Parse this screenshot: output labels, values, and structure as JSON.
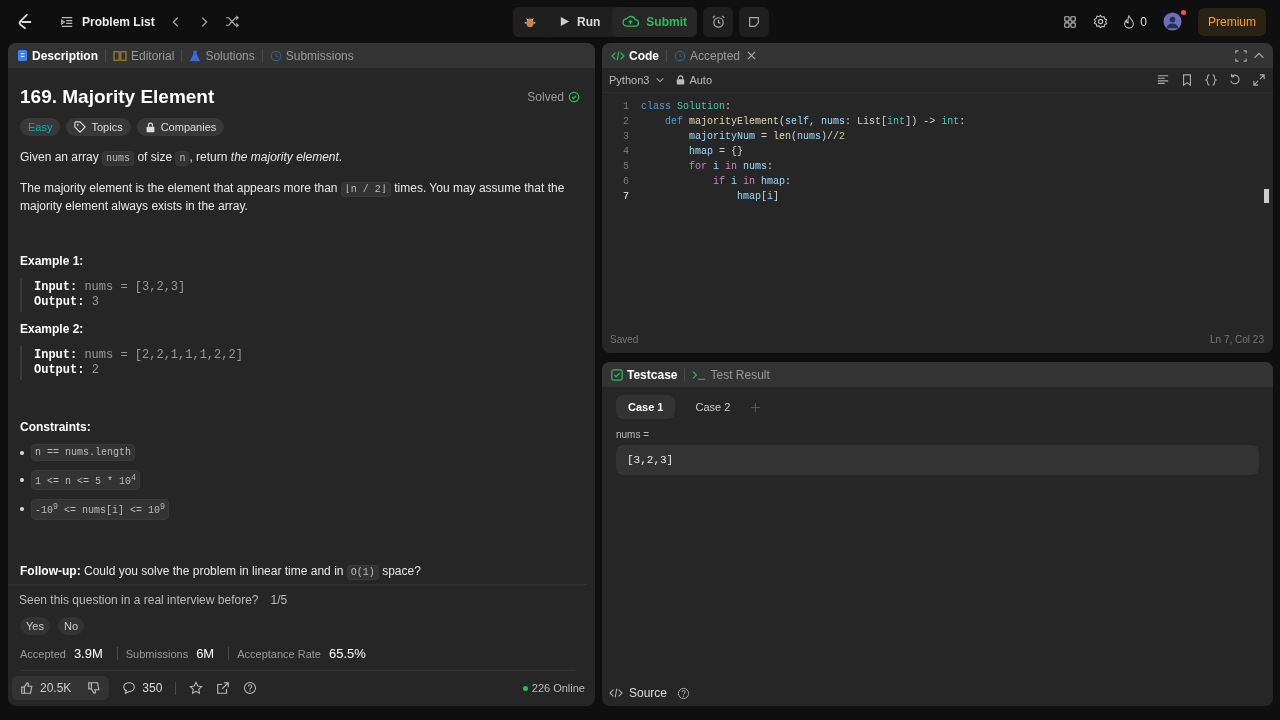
{
  "topbar": {
    "problem_list": "Problem List",
    "run": "Run",
    "submit": "Submit",
    "streak": "0",
    "premium": "Premium",
    "notification": true
  },
  "description_panel": {
    "tabs": [
      {
        "label": "Description",
        "selected": true
      },
      {
        "label": "Editorial",
        "selected": false
      },
      {
        "label": "Solutions",
        "selected": false
      },
      {
        "label": "Submissions",
        "selected": false
      }
    ],
    "title": "169. Majority Element",
    "status": "Solved",
    "difficulty": "Easy",
    "tags": [
      "Topics",
      "Companies"
    ],
    "paragraphs": [
      {
        "segments": [
          {
            "kind": "text",
            "text": "Given an array "
          },
          {
            "kind": "code",
            "text": "nums"
          },
          {
            "kind": "text",
            "text": " of size "
          },
          {
            "kind": "code",
            "text": "n"
          },
          {
            "kind": "text",
            "text": ", return "
          },
          {
            "kind": "em",
            "text": "the majority element"
          },
          {
            "kind": "text",
            "text": "."
          }
        ]
      },
      {
        "segments": [
          {
            "kind": "text",
            "text": "The majority element is the element that appears more than "
          },
          {
            "kind": "code",
            "text": "⌊n / 2⌋"
          },
          {
            "kind": "text",
            "text": " times. You may assume that the majority element always exists in the array."
          }
        ]
      }
    ],
    "examples": [
      {
        "title": "Example 1:",
        "input_label": "Input:",
        "input": "nums = [3,2,3]",
        "output_label": "Output:",
        "output": "3"
      },
      {
        "title": "Example 2:",
        "input_label": "Input:",
        "input": "nums = [2,2,1,1,1,2,2]",
        "output_label": "Output:",
        "output": "2"
      }
    ],
    "constraints_title": "Constraints:",
    "constraints": [
      "n == nums.length",
      "1 <= n <= 5 * 10$^{4}$",
      "-10$^{9}$ <= nums[i] <= 10$^{9}$"
    ],
    "followup": {
      "segments": [
        {
          "kind": "strong",
          "text": "Follow-up:"
        },
        {
          "kind": "text",
          "text": " Could you solve the problem in linear time and in "
        },
        {
          "kind": "code",
          "text": "O(1)"
        },
        {
          "kind": "text",
          "text": " space?"
        }
      ]
    },
    "interview": {
      "question": "Seen this question in a real interview before?",
      "count": "1/5",
      "buttons": [
        "Yes",
        "No"
      ]
    },
    "stats": [
      {
        "label": "Accepted",
        "value": "3.9M"
      },
      {
        "label": "Submissions",
        "value": "6M"
      },
      {
        "label": "Acceptance Rate",
        "value": "65.5%"
      }
    ],
    "footer": {
      "likes": "20.5K",
      "comments": "350",
      "online": "226 Online"
    }
  },
  "code_panel": {
    "tabs": [
      {
        "label": "Code",
        "selected": true
      },
      {
        "label": "Accepted",
        "selected": false
      }
    ],
    "language": "Python3",
    "mode": "Auto",
    "lines": [
      {
        "number": "1",
        "current": false,
        "tokens": [
          {
            "kind": "keyword",
            "text": "class"
          },
          {
            "kind": "type",
            "text": " Solution"
          },
          {
            "kind": "plain",
            "text": ":"
          }
        ]
      },
      {
        "number": "2",
        "current": false,
        "tokens": [
          {
            "kind": "keyword",
            "text": "    def"
          },
          {
            "kind": "function",
            "text": " majorityElement"
          },
          {
            "kind": "plain",
            "text": "("
          },
          {
            "kind": "variable",
            "text": "self"
          },
          {
            "kind": "plain",
            "text": ", "
          },
          {
            "kind": "variable",
            "text": "nums"
          },
          {
            "kind": "plain",
            "text": ": List["
          },
          {
            "kind": "type",
            "text": "int"
          },
          {
            "kind": "plain",
            "text": "]) -> "
          },
          {
            "kind": "type",
            "text": "int"
          },
          {
            "kind": "plain",
            "text": ":"
          }
        ]
      },
      {
        "number": "3",
        "current": false,
        "tokens": [
          {
            "kind": "variable",
            "text": "        majorityNum"
          },
          {
            "kind": "plain",
            "text": " = "
          },
          {
            "kind": "function",
            "text": "len"
          },
          {
            "kind": "plain",
            "text": "("
          },
          {
            "kind": "variable",
            "text": "nums"
          },
          {
            "kind": "plain",
            "text": ")//"
          },
          {
            "kind": "number",
            "text": "2"
          }
        ]
      },
      {
        "number": "4",
        "current": false,
        "tokens": [
          {
            "kind": "variable",
            "text": "        hmap"
          },
          {
            "kind": "plain",
            "text": " = {}"
          }
        ]
      },
      {
        "number": "5",
        "current": false,
        "tokens": [
          {
            "kind": "control",
            "text": "        for"
          },
          {
            "kind": "variable",
            "text": " i"
          },
          {
            "kind": "control",
            "text": " in"
          },
          {
            "kind": "variable",
            "text": " nums"
          },
          {
            "kind": "plain",
            "text": ":"
          }
        ]
      },
      {
        "number": "6",
        "current": false,
        "tokens": [
          {
            "kind": "control",
            "text": "            if"
          },
          {
            "kind": "variable",
            "text": " i"
          },
          {
            "kind": "control",
            "text": " in"
          },
          {
            "kind": "variable",
            "text": " hmap"
          },
          {
            "kind": "plain",
            "text": ":"
          }
        ]
      },
      {
        "number": "7",
        "current": true,
        "tokens": [
          {
            "kind": "variable",
            "text": "                hmap"
          },
          {
            "kind": "plain",
            "text": "["
          },
          {
            "kind": "variable",
            "text": "i"
          },
          {
            "kind": "plain",
            "text": "]"
          }
        ]
      }
    ],
    "status": "Saved",
    "cursor": "Ln 7, Col 23"
  },
  "testcase_panel": {
    "tabs": [
      {
        "label": "Testcase",
        "selected": true
      },
      {
        "label": "Test Result",
        "selected": false
      }
    ],
    "cases": [
      {
        "label": "Case 1",
        "selected": true
      },
      {
        "label": "Case 2",
        "selected": false
      }
    ],
    "param_label": "nums =",
    "param_value": "[3,2,3]",
    "source": "Source"
  }
}
